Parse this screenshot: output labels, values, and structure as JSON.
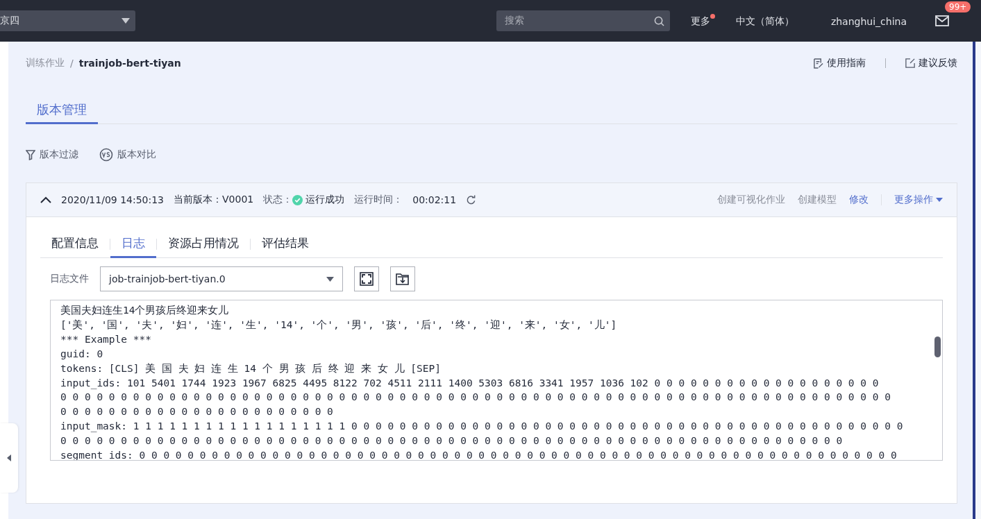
{
  "header": {
    "region": "京四",
    "search_placeholder": "搜索",
    "more": "更多",
    "more_has_dot": true,
    "language": "中文（简体）",
    "username": "zhanghui_china",
    "mail_badge": "99+"
  },
  "breadcrumb": [
    "训练作业",
    "trainjob-bert-tiyan"
  ],
  "breadcrumb_separator": "/",
  "help_links": [
    "使用指南",
    "建议反馈"
  ],
  "page_tabs": [
    {
      "label": "版本管理",
      "selected": true
    }
  ],
  "tools": [
    "版本过滤",
    "版本对比"
  ],
  "version": {
    "expanded": true,
    "datetime": "2020/11/09 14:50:13",
    "version_label": "当前版本：",
    "version": "V0001",
    "status_label": "状态：",
    "status": "运行成功",
    "runtime_label": "运行时间：",
    "runtime": "00:02:11",
    "actions": [
      {
        "label": "创建可视化作业",
        "kind": "link",
        "disabled": true
      },
      {
        "label": "创建模型",
        "kind": "link",
        "disabled": true
      },
      {
        "label": "修改",
        "kind": "link",
        "disabled": false
      },
      {
        "label": "更多操作",
        "kind": "dropdown",
        "disabled": false
      }
    ],
    "tabs": [
      {
        "label": "配置信息",
        "selected": false
      },
      {
        "label": "日志",
        "selected": true
      },
      {
        "label": "资源占用情况",
        "selected": false
      },
      {
        "label": "评估结果",
        "selected": false
      }
    ],
    "log_file_label": "日志文件",
    "log_file": "job-trainjob-bert-tiyan.0",
    "log_lines": [
      "美国夫妇连生14个男孩后终迎来女儿",
      "['美', '国', '夫', '妇', '连', '生', '14', '个', '男', '孩', '后', '终', '迎', '来', '女', '儿']",
      "*** Example ***",
      "guid: 0",
      "tokens: [CLS] 美 国 夫 妇 连 生 14 个 男 孩 后 终 迎 来 女 儿 [SEP]",
      "input_ids: 101 5401 1744 1923 1967 6825 4495 8122 702 4511 2111 1400 5303 6816 3341 1957 1036 102 0 0 0 0 0 0 0 0 0 0 0 0 0 0 0 0 0 0 0",
      "0 0 0 0 0 0 0 0 0 0 0 0 0 0 0 0 0 0 0 0 0 0 0 0 0 0 0 0 0 0 0 0 0 0 0 0 0 0 0 0 0 0 0 0 0 0 0 0 0 0 0 0 0 0 0 0 0 0 0 0 0 0 0 0 0 0 0 0 0",
      "0 0 0 0 0 0 0 0 0 0 0 0 0 0 0 0 0 0 0 0 0 0 0",
      "input_mask: 1 1 1 1 1 1 1 1 1 1 1 1 1 1 1 1 1 1 0 0 0 0 0 0 0 0 0 0 0 0 0 0 0 0 0 0 0 0 0 0 0 0 0 0 0 0 0 0 0 0 0 0 0 0 0 0 0 0 0 0 0 0 0 0",
      "0 0 0 0 0 0 0 0 0 0 0 0 0 0 0 0 0 0 0 0 0 0 0 0 0 0 0 0 0 0 0 0 0 0 0 0 0 0 0 0 0 0 0 0 0 0 0 0 0 0 0 0 0 0 0 0 0 0 0 0 0 0 0 0 0",
      "segment_ids: 0 0 0 0 0 0 0 0 0 0 0 0 0 0 0 0 0 0 0 0 0 0 0 0 0 0 0 0 0 0 0 0 0 0 0 0 0 0 0 0 0 0 0 0 0 0 0 0 0 0 0 0 0 0 0 0 0 0 0 0 0 0 0"
    ]
  }
}
